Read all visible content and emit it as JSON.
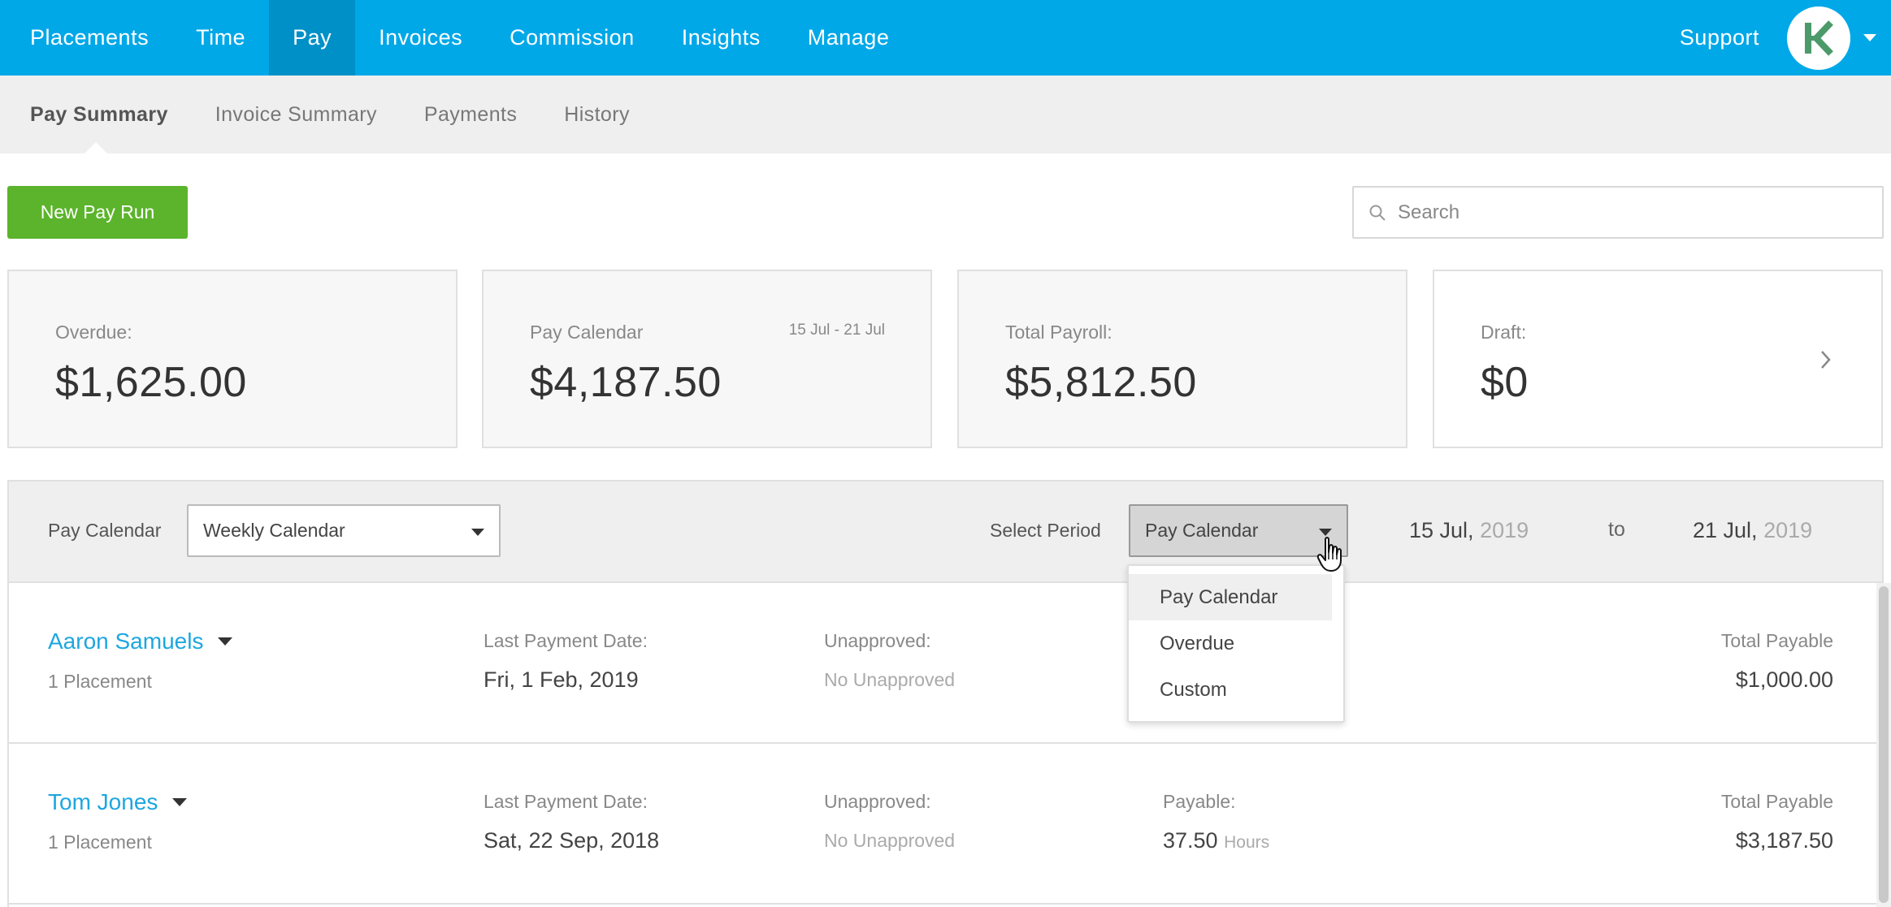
{
  "topnav": {
    "items": [
      {
        "label": "Placements"
      },
      {
        "label": "Time"
      },
      {
        "label": "Pay"
      },
      {
        "label": "Invoices"
      },
      {
        "label": "Commission"
      },
      {
        "label": "Insights"
      },
      {
        "label": "Manage"
      }
    ],
    "active": "Pay",
    "support_label": "Support",
    "brand_color": "#00a8e8",
    "active_color": "#0090c8"
  },
  "subnav": {
    "items": [
      {
        "label": "Pay Summary"
      },
      {
        "label": "Invoice Summary"
      },
      {
        "label": "Payments"
      },
      {
        "label": "History"
      }
    ],
    "active": "Pay Summary"
  },
  "toolbar": {
    "new_pay_run_label": "New Pay Run",
    "new_pay_run_color": "#5bb42b",
    "search_placeholder": "Search"
  },
  "cards": {
    "overdue": {
      "label": "Overdue:",
      "value": "$1,625.00"
    },
    "pay_calendar": {
      "label": "Pay Calendar",
      "range": "15 Jul - 21 Jul",
      "value": "$4,187.50"
    },
    "total_payroll": {
      "label": "Total Payroll:",
      "value": "$5,812.50"
    },
    "draft": {
      "label": "Draft:",
      "value": "$0"
    }
  },
  "filter": {
    "pay_calendar_label": "Pay Calendar",
    "pay_calendar_value": "Weekly Calendar",
    "select_period_label": "Select Period",
    "select_period_value": "Pay Calendar",
    "from_day": "15 Jul,",
    "from_year": "2019",
    "to_label": "to",
    "to_day": "21 Jul,",
    "to_year": "2019"
  },
  "period_dropdown": {
    "options": [
      "Pay Calendar",
      "Overdue",
      "Custom"
    ],
    "selected": "Pay Calendar"
  },
  "rows": [
    {
      "name": "Aaron Samuels",
      "placements": "1 Placement",
      "last_payment_label": "Last Payment Date:",
      "last_payment_value": "Fri, 1 Feb, 2019",
      "unapproved_label": "Unapproved:",
      "unapproved_value": "No Unapproved",
      "total_label": "Total Payable",
      "total_value": "$1,000.00"
    },
    {
      "name": "Tom Jones",
      "placements": "1 Placement",
      "last_payment_label": "Last Payment Date:",
      "last_payment_value": "Sat, 22 Sep, 2018",
      "unapproved_label": "Unapproved:",
      "unapproved_value": "No Unapproved",
      "payable_label": "Payable:",
      "payable_value": "37.50",
      "payable_unit": "Hours",
      "total_label": "Total Payable",
      "total_value": "$3,187.50"
    }
  ],
  "link_color": "#1ea6df"
}
